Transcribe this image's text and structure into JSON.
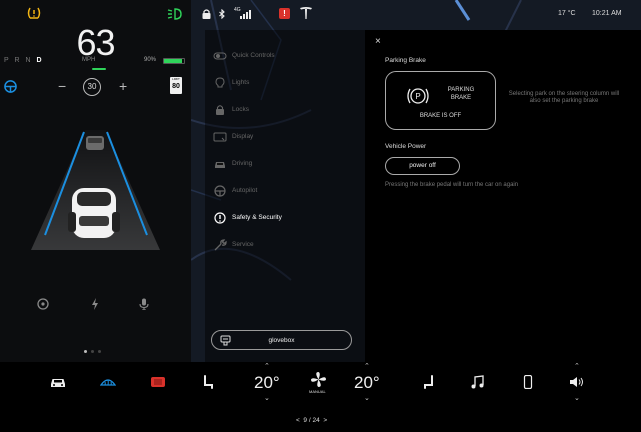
{
  "colors": {
    "accent_green": "#2fd45a",
    "warning_yellow": "#f2b514",
    "alert_red": "#d9322b",
    "autopilot_blue": "#1b8fe0"
  },
  "cluster": {
    "speed": "63",
    "speed_unit": "MPH",
    "gears": [
      "P",
      "R",
      "N",
      "D"
    ],
    "selected_gear": "D",
    "battery_percent_label": "90%",
    "battery_fraction": 0.9,
    "speed_limit_set": "30",
    "speed_limit_sign_label": "LIMIT",
    "speed_limit_sign_value": "80",
    "minus_label": "−",
    "plus_label": "+",
    "icons": [
      "tire-pressure-warning-icon",
      "lamp-icon",
      "steering-wheel-icon",
      "media-icon",
      "lightning-icon",
      "mic-icon"
    ]
  },
  "status": {
    "network": "4G",
    "temperature": "17 °C",
    "time": "10:21 AM",
    "sos_label": "!"
  },
  "menu": {
    "items": [
      {
        "label": "Quick Controls",
        "icon": "toggle-icon"
      },
      {
        "label": "Lights",
        "icon": "bulb-icon"
      },
      {
        "label": "Locks",
        "icon": "lock-icon"
      },
      {
        "label": "Display",
        "icon": "display-icon"
      },
      {
        "label": "Driving",
        "icon": "car-icon"
      },
      {
        "label": "Autopilot",
        "icon": "steering-wheel-icon"
      },
      {
        "label": "Safety & Security",
        "icon": "info-icon"
      },
      {
        "label": "Service",
        "icon": "wrench-icon"
      }
    ],
    "active": "Safety & Security",
    "glovebox_label": "glovebox"
  },
  "panel": {
    "close_label": "×",
    "parking_brake_title": "Parking Brake",
    "parking_brake_button_label": "PARKING BRAKE",
    "parking_brake_status": "BRAKE IS OFF",
    "parking_brake_note": "Selecting park on the steering column will also set the parking brake",
    "vehicle_power_title": "Vehicle Power",
    "power_off_label": "power off",
    "vehicle_power_note": "Pressing the brake pedal will turn the car on again"
  },
  "bottom": {
    "driver_temp": "20°",
    "passenger_temp": "20°",
    "fan_mode": "MANUAL",
    "page_indicator": "9 / 24",
    "prev_label": "<",
    "next_label": ">"
  }
}
